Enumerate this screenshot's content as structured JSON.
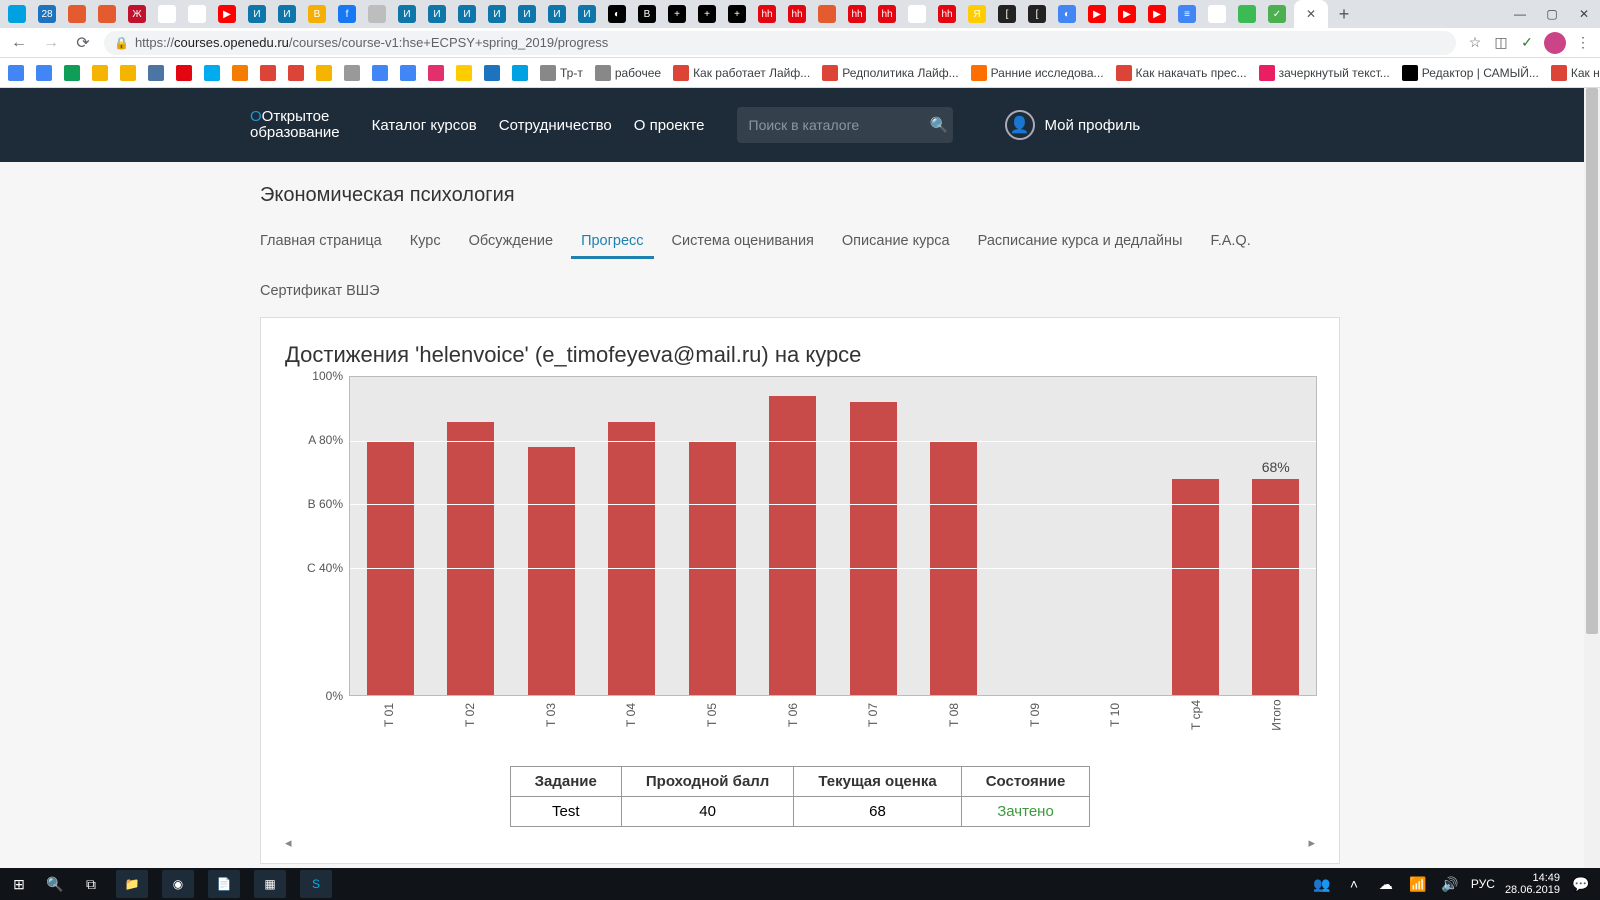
{
  "browser": {
    "url_full": "https://courses.openedu.ru/courses/course-v1:hse+ECPSY+spring_2019/progress",
    "url_display_domain": "courses.openedu.ru",
    "url_display_path": "/courses/course-v1:hse+ECPSY+spring_2019/progress",
    "tabs_count": 44,
    "tab_favicons": [
      {
        "bg": "#00a1e0"
      },
      {
        "bg": "#1e73be",
        "txt": "28"
      },
      {
        "bg": "#e35b2e"
      },
      {
        "bg": "#e35b2e"
      },
      {
        "bg": "#c1122d",
        "txt": "Ж"
      },
      {
        "bg": "#ffffff"
      },
      {
        "bg": "#ffffff"
      },
      {
        "bg": "#ff0000",
        "txt": "▶"
      },
      {
        "bg": "#0e76a8",
        "txt": "И"
      },
      {
        "bg": "#0e76a8",
        "txt": "И"
      },
      {
        "bg": "#f5af02",
        "txt": "B"
      },
      {
        "bg": "#1877f2",
        "txt": "f"
      },
      {
        "bg": "#bdbdbd"
      },
      {
        "bg": "#0e76a8",
        "txt": "И"
      },
      {
        "bg": "#0e76a8",
        "txt": "И"
      },
      {
        "bg": "#0e76a8",
        "txt": "И"
      },
      {
        "bg": "#0e76a8",
        "txt": "И"
      },
      {
        "bg": "#0e76a8",
        "txt": "И"
      },
      {
        "bg": "#0e76a8",
        "txt": "И"
      },
      {
        "bg": "#0e76a8",
        "txt": "И"
      },
      {
        "bg": "#000000",
        "txt": "◐"
      },
      {
        "bg": "#000000",
        "txt": "B"
      },
      {
        "bg": "#000000",
        "txt": "+"
      },
      {
        "bg": "#000000",
        "txt": "+"
      },
      {
        "bg": "#000000",
        "txt": "+"
      },
      {
        "bg": "#e30611",
        "txt": "hh"
      },
      {
        "bg": "#e30611",
        "txt": "hh"
      },
      {
        "bg": "#e35b2e"
      },
      {
        "bg": "#e30611",
        "txt": "hh"
      },
      {
        "bg": "#e30611",
        "txt": "hh"
      },
      {
        "bg": "#ffffff"
      },
      {
        "bg": "#e30611",
        "txt": "hh"
      },
      {
        "bg": "#ffcc00",
        "txt": "Я"
      },
      {
        "bg": "#222222",
        "txt": "["
      },
      {
        "bg": "#222222",
        "txt": "["
      },
      {
        "bg": "#4285f4",
        "txt": "◐"
      },
      {
        "bg": "#ff0000",
        "txt": "▶"
      },
      {
        "bg": "#ff0000",
        "txt": "▶"
      },
      {
        "bg": "#ff0000",
        "txt": "▶"
      },
      {
        "bg": "#4285f4",
        "txt": "≡"
      },
      {
        "bg": "#ffffff",
        "txt": "W"
      },
      {
        "bg": "#3cba54"
      },
      {
        "bg": "#4caf50",
        "txt": "✓"
      }
    ]
  },
  "bookmarks": [
    {
      "bg": "#4285f4",
      "label": ""
    },
    {
      "bg": "#4285f4",
      "label": ""
    },
    {
      "bg": "#0f9d58",
      "label": ""
    },
    {
      "bg": "#f4b400",
      "label": ""
    },
    {
      "bg": "#f4b400",
      "label": ""
    },
    {
      "bg": "#4c75a3",
      "label": ""
    },
    {
      "bg": "#e30611",
      "label": ""
    },
    {
      "bg": "#00acee",
      "label": ""
    },
    {
      "bg": "#f57c00",
      "label": ""
    },
    {
      "bg": "#db4437",
      "label": ""
    },
    {
      "bg": "#db4437",
      "label": ""
    },
    {
      "bg": "#f4b400",
      "label": ""
    },
    {
      "bg": "#999999",
      "label": ""
    },
    {
      "bg": "#4285f4",
      "label": ""
    },
    {
      "bg": "#4285f4",
      "label": ""
    },
    {
      "bg": "#e1306c",
      "label": ""
    },
    {
      "bg": "#ffcc00",
      "label": ""
    },
    {
      "bg": "#1e73be",
      "label": ""
    },
    {
      "bg": "#00a1e0",
      "label": ""
    },
    {
      "bg": "#888888",
      "label": "Тр-т"
    },
    {
      "bg": "#888888",
      "label": "рабочее"
    },
    {
      "bg": "#db4437",
      "label": "Как работает Лайф..."
    },
    {
      "bg": "#db4437",
      "label": "Редполитика Лайф..."
    },
    {
      "bg": "#ff6f00",
      "label": "Ранние исследова..."
    },
    {
      "bg": "#db4437",
      "label": "Как накачать прес..."
    },
    {
      "bg": "#e91e63",
      "label": "зачеркнутый текст..."
    },
    {
      "bg": "#000000",
      "label": "Редактор | САМЫЙ..."
    },
    {
      "bg": "#db4437",
      "label": "Как научиться пла..."
    }
  ],
  "header": {
    "logo_line1": "Открытое",
    "logo_line2": "образование",
    "nav": [
      "Каталог курсов",
      "Сотрудничество",
      "О проекте"
    ],
    "search_placeholder": "Поиск в каталоге",
    "profile_label": "Мой профиль"
  },
  "course": {
    "title": "Экономическая психология",
    "tabs": [
      "Главная страница",
      "Курс",
      "Обсуждение",
      "Прогресс",
      "Система оценивания",
      "Описание курса",
      "Расписание курса и дедлайны",
      "F.A.Q."
    ],
    "tabs_row2": [
      "Сертификат ВШЭ"
    ],
    "active_tab_index": 3
  },
  "panel": {
    "title": "Достижения 'helenvoice' (e_timofeyeva@mail.ru) на курсе"
  },
  "chart_data": {
    "type": "bar",
    "title": "",
    "ylabel": "",
    "xlabel": "",
    "ylim": [
      0,
      100
    ],
    "y_ticks": [
      {
        "v": 100,
        "label": "100%"
      },
      {
        "v": 80,
        "label": "A 80%"
      },
      {
        "v": 60,
        "label": "B 60%"
      },
      {
        "v": 40,
        "label": "C 40%"
      },
      {
        "v": 0,
        "label": "0%"
      }
    ],
    "categories": [
      "Т 01",
      "Т 02",
      "Т 03",
      "Т 04",
      "Т 05",
      "Т 06",
      "Т 07",
      "Т 08",
      "Т 09",
      "Т 10",
      "Т ср4",
      "Итого"
    ],
    "values": [
      80,
      86,
      78,
      86,
      80,
      94,
      92,
      80,
      0,
      0,
      68,
      68
    ],
    "value_labels": {
      "11": "68%"
    },
    "bar_color": "#c84a49"
  },
  "table": {
    "headers": [
      "Задание",
      "Проходной балл",
      "Текущая оценка",
      "Состояние"
    ],
    "rows": [
      {
        "task": "Test",
        "pass_score": "40",
        "current": "68",
        "state": "Зачтено",
        "state_pass": true
      }
    ]
  },
  "taskbar": {
    "time": "14:49",
    "date": "28.06.2019",
    "lang": "РУС"
  }
}
